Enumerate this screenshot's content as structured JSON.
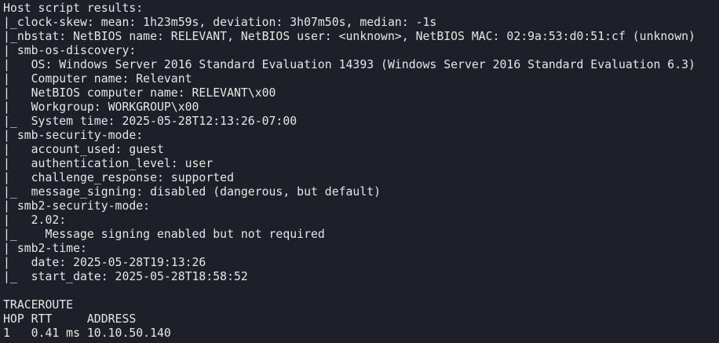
{
  "terminal": {
    "lines": [
      "Host script results:",
      "|_clock-skew: mean: 1h23m59s, deviation: 3h07m50s, median: -1s",
      "|_nbstat: NetBIOS name: RELEVANT, NetBIOS user: <unknown>, NetBIOS MAC: 02:9a:53:d0:51:cf (unknown)",
      "| smb-os-discovery:",
      "|   OS: Windows Server 2016 Standard Evaluation 14393 (Windows Server 2016 Standard Evaluation 6.3)",
      "|   Computer name: Relevant",
      "|   NetBIOS computer name: RELEVANT\\x00",
      "|   Workgroup: WORKGROUP\\x00",
      "|_  System time: 2025-05-28T12:13:26-07:00",
      "| smb-security-mode:",
      "|   account_used: guest",
      "|   authentication_level: user",
      "|   challenge_response: supported",
      "|_  message_signing: disabled (dangerous, but default)",
      "| smb2-security-mode:",
      "|   2.02:",
      "|_    Message signing enabled but not required",
      "| smb2-time:",
      "|   date: 2025-05-28T19:13:26",
      "|_  start_date: 2025-05-28T18:58:52",
      "",
      "TRACEROUTE",
      "HOP RTT     ADDRESS",
      "1   0.41 ms 10.10.50.140"
    ]
  }
}
